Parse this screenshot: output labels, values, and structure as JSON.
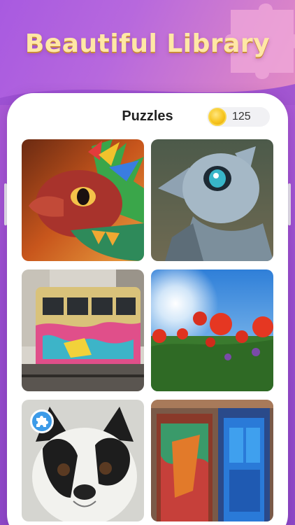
{
  "banner": {
    "title": "Beautiful Library"
  },
  "header": {
    "title": "Puzzles",
    "coins": "125"
  },
  "icons": {
    "coin": "coin-icon",
    "puzzle_badge": "puzzle-piece-icon"
  },
  "puzzles": [
    {
      "subject": "rainbow baby dragon"
    },
    {
      "subject": "blue-eyed baby dragon"
    },
    {
      "subject": "graffiti tram"
    },
    {
      "subject": "red poppies under sun"
    },
    {
      "subject": "french bulldog"
    },
    {
      "subject": "painted wooden doors"
    }
  ],
  "colors": {
    "brand_purple": "#a85ae0",
    "title_gold": "#ffe7a6",
    "badge_blue": "#3d9be8"
  }
}
